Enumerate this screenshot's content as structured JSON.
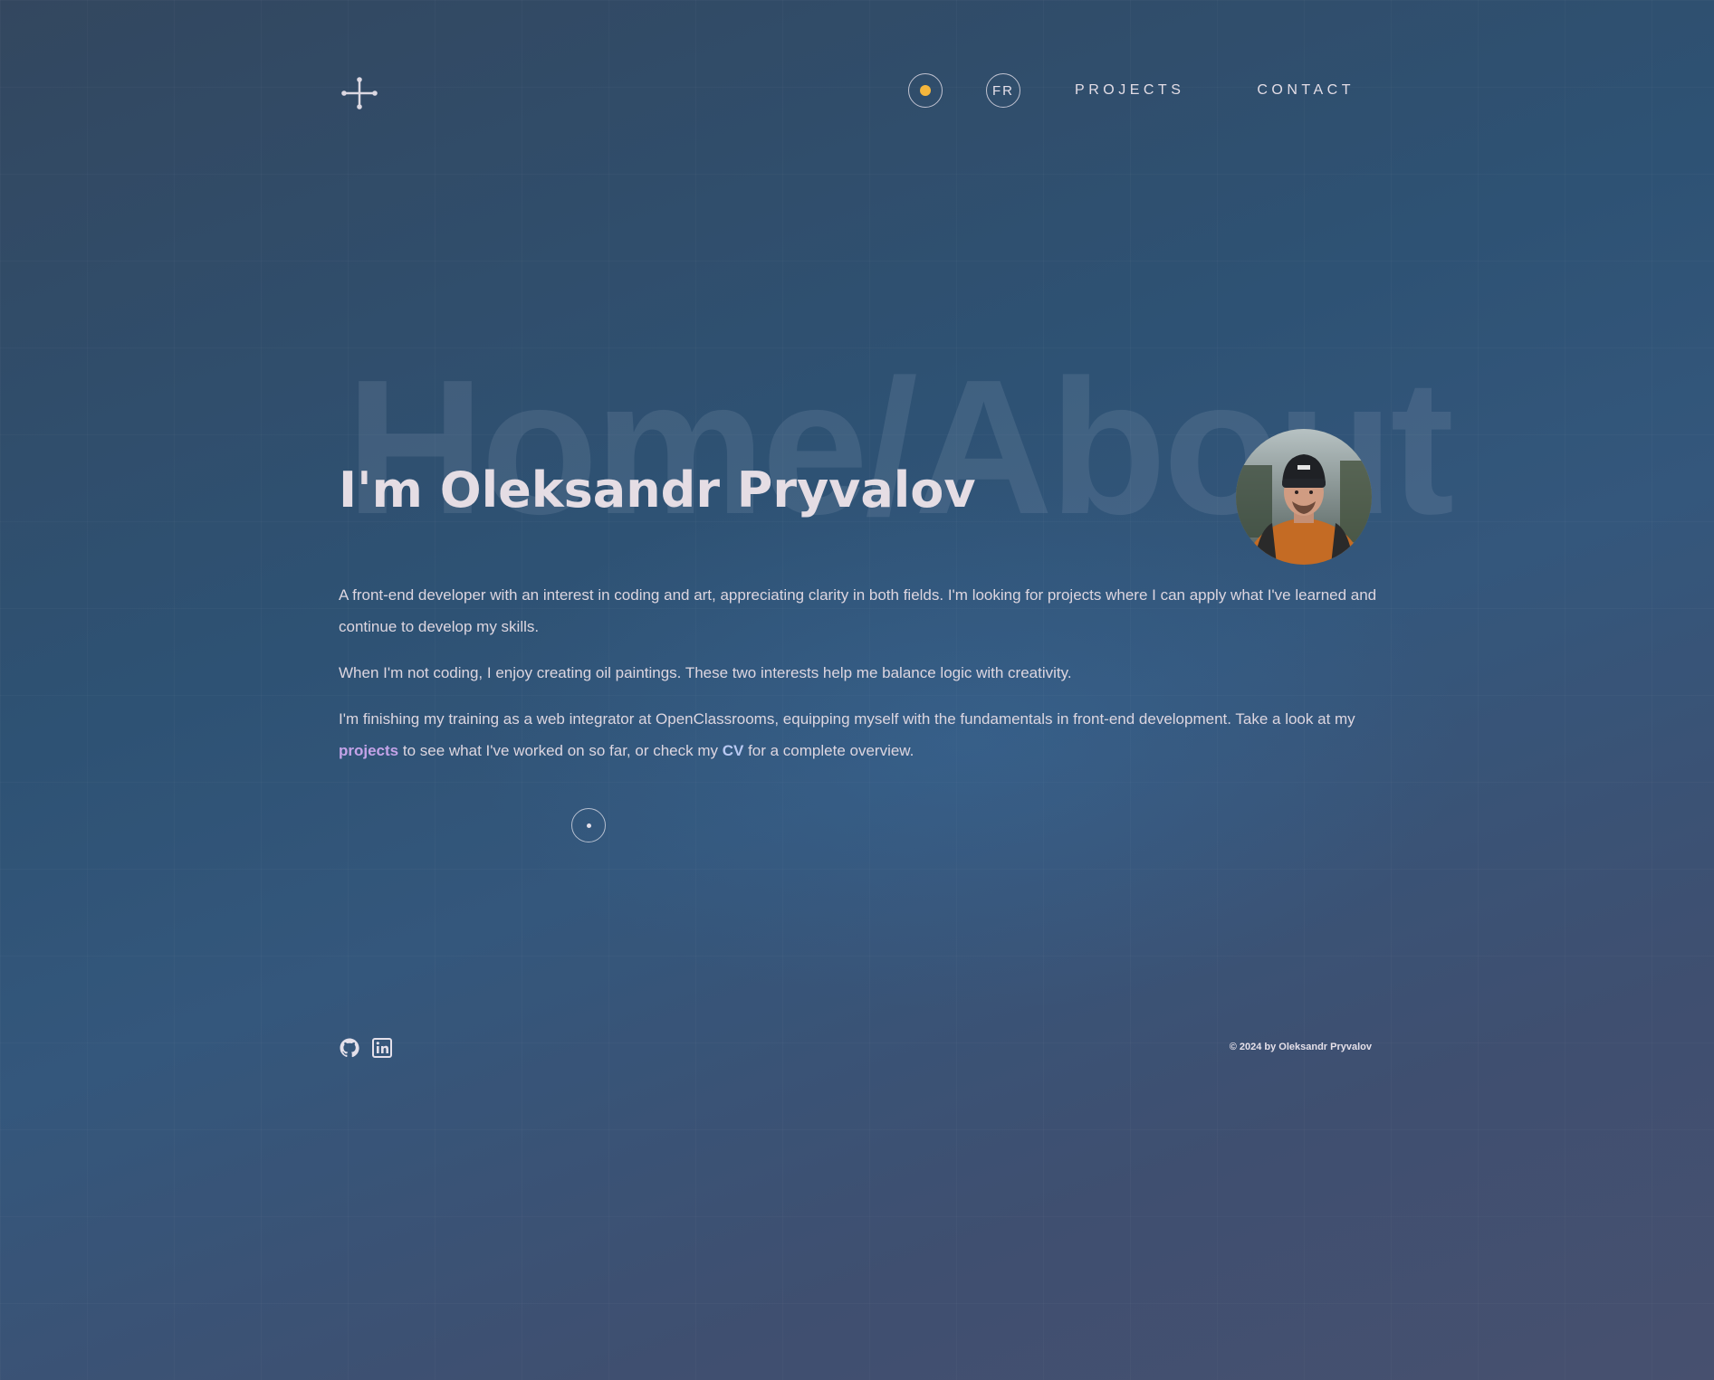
{
  "header": {
    "logo_icon": "network-cross-icon",
    "theme_toggle_icon": "sun-dot-icon",
    "theme_accent_color": "#f4b63c",
    "language_button": "FR",
    "nav": [
      {
        "label": "PROJECTS"
      },
      {
        "label": "CONTACT"
      }
    ]
  },
  "hero": {
    "background_word": "Home/About",
    "title": "I'm Oleksandr Pryvalov",
    "avatar_icon": "profile-photo",
    "paragraphs": {
      "p1": "A front-end developer with an interest in coding and art, appreciating clarity in both fields. I'm looking for projects where I can apply what I've learned and continue to develop my skills.",
      "p2": "When I'm not coding, I enjoy creating oil paintings. These two interests help me balance logic with creativity.",
      "p3_before": "I'm finishing my training as a web integrator at OpenClassrooms, equipping myself with the fundamentals in front-end development. Take a look at my ",
      "p3_link_projects": "projects",
      "p3_middle": " to see what I've worked on so far, or check my ",
      "p3_link_cv": "CV",
      "p3_after": " for a complete overview."
    },
    "scroll_icon": "scroll-dot-icon"
  },
  "footer": {
    "social": [
      {
        "icon": "github-icon"
      },
      {
        "icon": "linkedin-icon"
      }
    ],
    "copyright": "© 2024 by Oleksandr Pryvalov"
  }
}
